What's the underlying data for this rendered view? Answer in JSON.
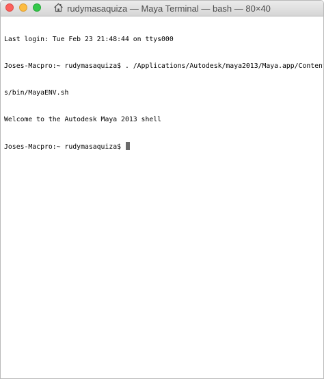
{
  "window": {
    "title": "rudymasaquiza — Maya Terminal — bash — 80×40",
    "title_icon": "home-icon"
  },
  "traffic_lights": {
    "close_color": "#fc605c",
    "minimize_color": "#fdbc40",
    "zoom_color": "#34c84a"
  },
  "terminal": {
    "lines": [
      "Last login: Tue Feb 23 21:48:44 on ttys000",
      "Joses-Macpro:~ rudymasaquiza$ . /Applications/Autodesk/maya2013/Maya.app/Content",
      "s/bin/MayaENV.sh",
      "Welcome to the Autodesk Maya 2013 shell"
    ],
    "prompt": "Joses-Macpro:~ rudymasaquiza$ "
  }
}
